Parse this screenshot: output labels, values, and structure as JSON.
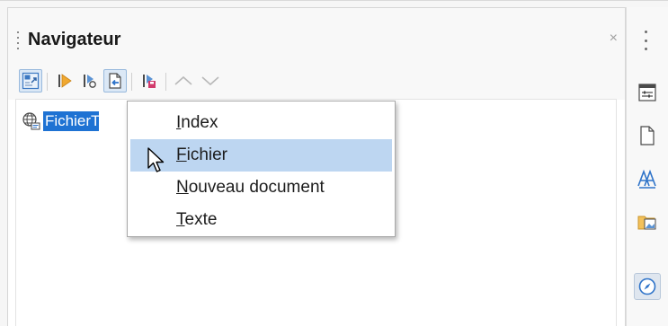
{
  "panel": {
    "title": "Navigateur",
    "close_symbol": "×"
  },
  "toolbar": {
    "buttons": [
      {
        "icon": "toggle-view-icon",
        "pressed": true
      },
      {
        "icon": "promote-level-icon"
      },
      {
        "icon": "demote-level-icon"
      },
      {
        "icon": "insert-icon",
        "pressed": true
      },
      {
        "icon": "save-contents-icon"
      },
      {
        "icon": "move-up-icon",
        "disabled": true
      },
      {
        "icon": "move-down-icon",
        "disabled": true
      }
    ]
  },
  "tree": {
    "items": [
      {
        "label": "FichierTe",
        "icon": "globe-document-icon",
        "selected": true
      }
    ]
  },
  "menu": {
    "items": [
      {
        "pre": "",
        "acc": "I",
        "post": "ndex"
      },
      {
        "pre": "",
        "acc": "F",
        "post": "ichier",
        "hover": true
      },
      {
        "pre": "",
        "acc": "N",
        "post": "ouveau document"
      },
      {
        "pre": "",
        "acc": "T",
        "post": "exte"
      }
    ]
  },
  "sidebar": {
    "buttons": [
      {
        "icon": "properties-icon"
      },
      {
        "icon": "page-icon"
      },
      {
        "icon": "styles-icon"
      },
      {
        "icon": "gallery-icon"
      },
      {
        "icon": "navigator-icon",
        "active": true
      }
    ]
  },
  "colors": {
    "selection": "#1e72d3",
    "menu_hover": "#bdd6f1",
    "pressed_bg": "#dbe8f6"
  }
}
